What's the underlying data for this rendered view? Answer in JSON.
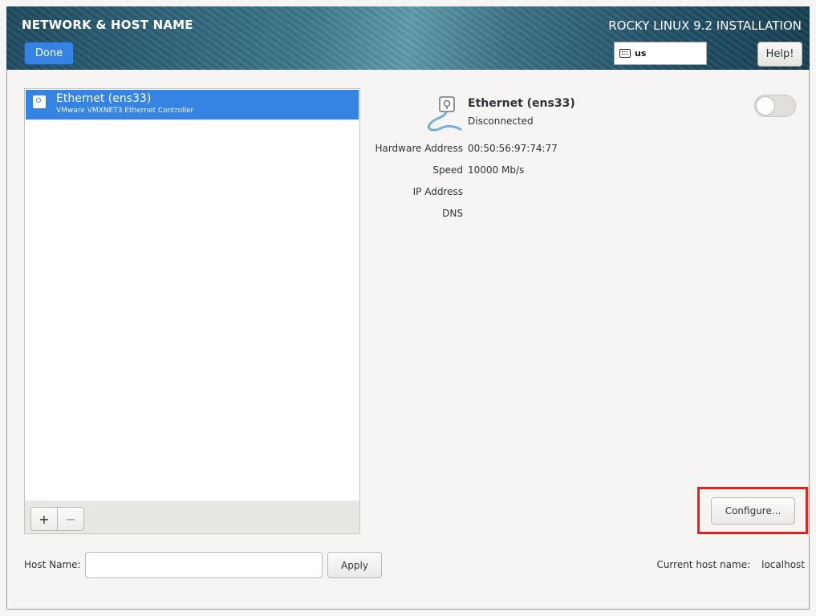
{
  "header": {
    "spoke_title": "NETWORK & HOST NAME",
    "done_label": "Done",
    "product_title": "ROCKY LINUX 9.2 INSTALLATION",
    "keyboard_layout": "us",
    "help_label": "Help!"
  },
  "devices": [
    {
      "name": "Ethernet (ens33)",
      "description": "VMware VMXNET3 Ethernet Controller",
      "selected": true
    }
  ],
  "list_toolbar": {
    "add_label": "+",
    "remove_label": "−"
  },
  "details": {
    "name": "Ethernet (ens33)",
    "status": "Disconnected",
    "enabled": false,
    "properties": [
      {
        "label": "Hardware Address",
        "value": "00:50:56:97:74:77"
      },
      {
        "label": "Speed",
        "value": "10000 Mb/s"
      },
      {
        "label": "IP Address",
        "value": ""
      },
      {
        "label": "DNS",
        "value": ""
      }
    ],
    "configure_label": "Configure..."
  },
  "hostname": {
    "label": "Host Name:",
    "value": "",
    "placeholder": "",
    "apply_label": "Apply",
    "current_label": "Current host name:",
    "current_value": "localhost"
  },
  "colors": {
    "accent": "#3584e4",
    "highlight": "#e8231b"
  }
}
